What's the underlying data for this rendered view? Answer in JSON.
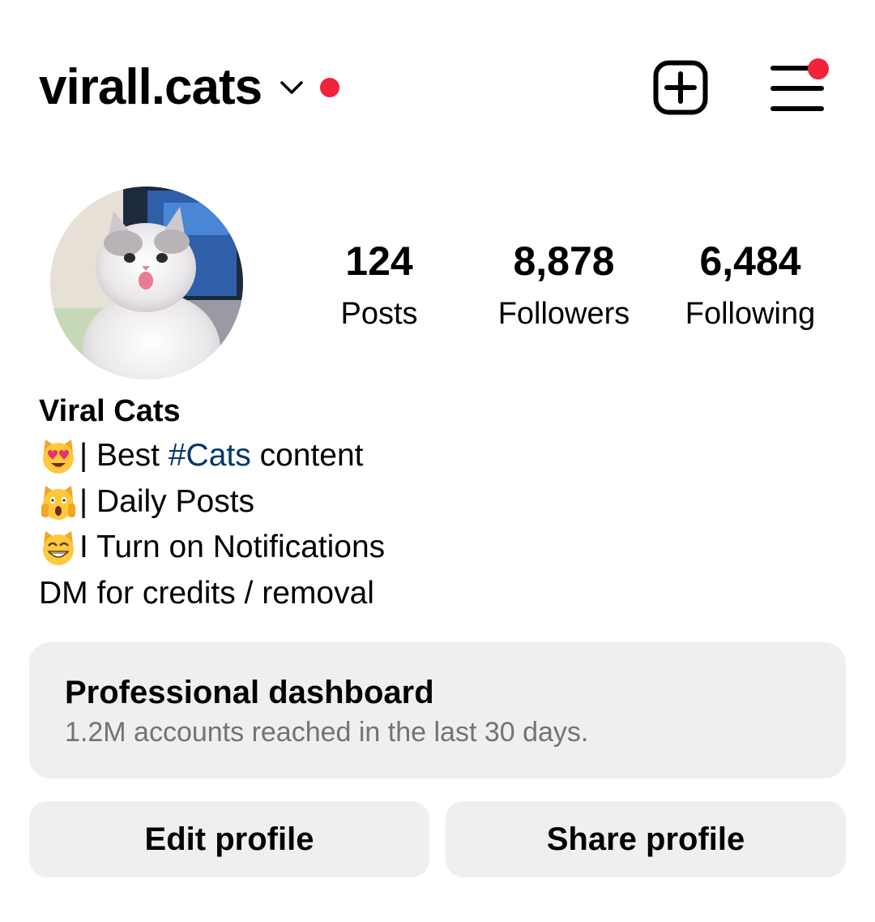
{
  "header": {
    "username": "virall.cats",
    "icons": {
      "account_switcher": "chevron-down-icon",
      "create": "plus-square-icon",
      "menu": "hamburger-menu-icon"
    },
    "accent_color": "#f0233b"
  },
  "profile": {
    "avatar_alt": "profile-picture-white-cat",
    "stats": [
      {
        "value": "124",
        "label": "Posts"
      },
      {
        "value": "8,878",
        "label": "Followers"
      },
      {
        "value": "6,484",
        "label": "Following"
      }
    ]
  },
  "bio": {
    "name": "Viral Cats",
    "lines": [
      {
        "emoji": "smiling-cat-heart-eyes-emoji",
        "prefix": "| Best ",
        "hashtag": "#Cats",
        "suffix": " content"
      },
      {
        "emoji": "weary-cat-emoji",
        "text": "| Daily Posts"
      },
      {
        "emoji": "grinning-cat-emoji",
        "text": "I Turn on Notifications"
      }
    ],
    "last_line": "DM for credits / removal",
    "hashtag_color": "#00376b"
  },
  "dashboard": {
    "title": "Professional dashboard",
    "subtitle": "1.2M accounts reached in the last 30 days."
  },
  "actions": {
    "edit_label": "Edit profile",
    "share_label": "Share profile"
  }
}
